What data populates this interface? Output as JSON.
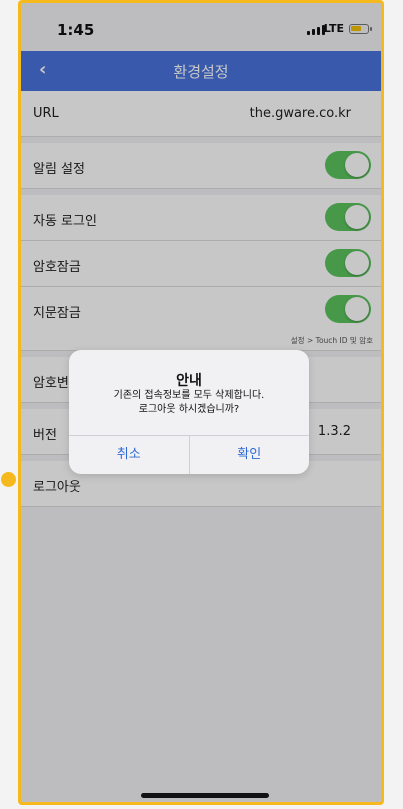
{
  "status_bar": {
    "time": "1:45",
    "network": "LTE"
  },
  "navbar": {
    "back": "‹",
    "title": "환경설정"
  },
  "settings": {
    "url_label": "URL",
    "url_value": "the.gware.co.kr",
    "notification_label": "알림 설정",
    "autologin_label": "자동 로그인",
    "passcode_lock_label": "암호잠금",
    "fingerprint_lock_label": "지문잠금",
    "fingerprint_note": "설정 > Touch ID 및 암호",
    "change_password_label": "암호변경",
    "version_label": "버전",
    "version_value": "1.3.2",
    "logout_label": "로그아웃"
  },
  "dialog": {
    "title": "안내",
    "message_line1": "기존의 접속정보를 모두 삭제합니다.",
    "message_line2": "로그아웃 하시겠습니까?",
    "cancel_label": "취소",
    "confirm_label": "확인"
  },
  "colors": {
    "accent": "#4a74dd",
    "toggle_on": "#5bc55e",
    "frame": "#f6b91d",
    "dialog_button": "#2f6bd6"
  }
}
